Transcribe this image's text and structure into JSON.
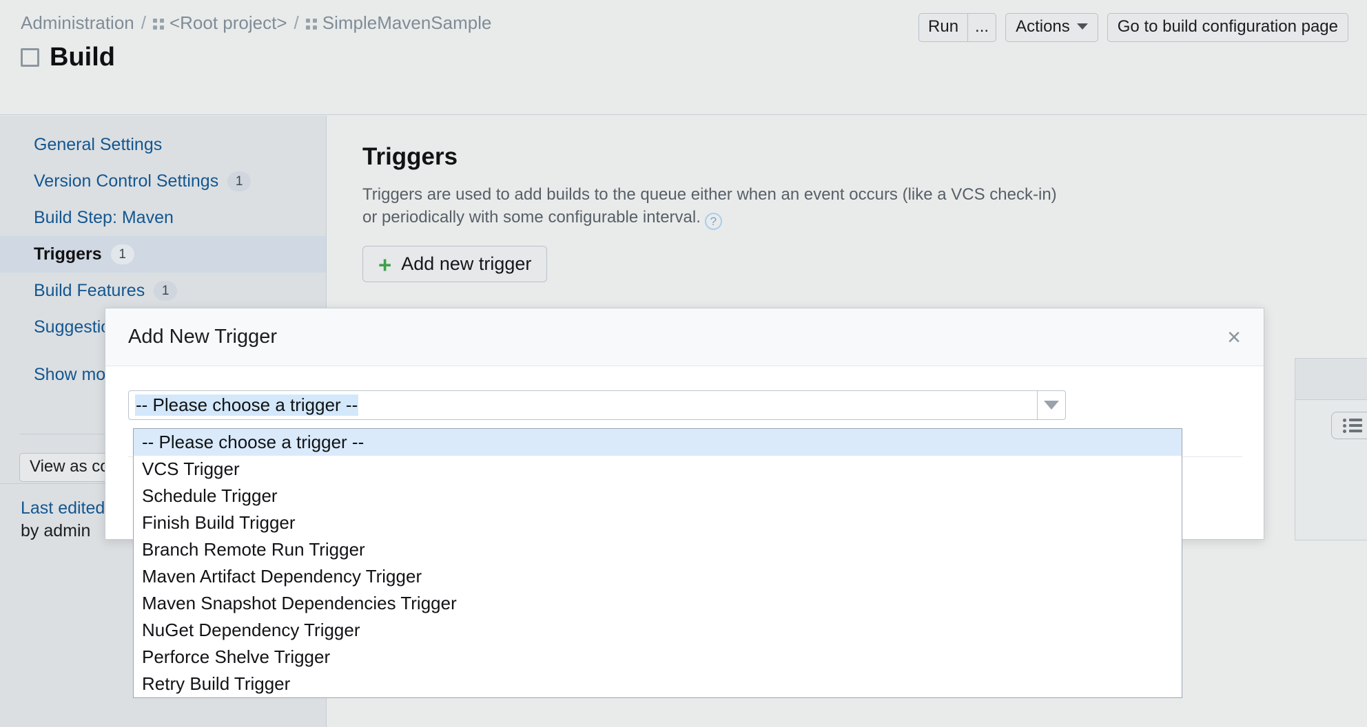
{
  "header": {
    "breadcrumb": [
      {
        "label": "Administration",
        "icon": null
      },
      {
        "label": "<Root project>",
        "icon": "grid-icon"
      },
      {
        "label": "SimpleMavenSample",
        "icon": "grid-icon"
      }
    ],
    "separator": "/",
    "page_title": "Build",
    "actions": {
      "run_label": "Run",
      "run_more_label": "...",
      "actions_label": "Actions",
      "goto_label": "Go to build configuration page"
    }
  },
  "sidebar": {
    "items": [
      {
        "label": "General Settings",
        "badge": null,
        "active": false
      },
      {
        "label": "Version Control Settings",
        "badge": "1",
        "active": false
      },
      {
        "label": "Build Step: Maven",
        "badge": null,
        "active": false
      },
      {
        "label": "Triggers",
        "badge": "1",
        "active": true
      },
      {
        "label": "Build Features",
        "badge": "1",
        "active": false
      },
      {
        "label": "Suggestions",
        "badge": null,
        "active": false
      },
      {
        "label": "Show more",
        "badge": null,
        "active": false
      }
    ],
    "footer": {
      "last_edited": "Last edited",
      "by_line": "by admin",
      "view_as_code_label": "View as code"
    }
  },
  "main": {
    "title": "Triggers",
    "description": "Triggers are used to add builds to the queue either when an event occurs (like a VCS check-in) or periodically with some configurable interval.",
    "help_icon": "?",
    "add_trigger_label": "Add new trigger",
    "add_trigger_plus": "+",
    "list_view_button": "list-view-icon"
  },
  "modal": {
    "title": "Add New Trigger",
    "close_label": "×",
    "select": {
      "value": "-- Please choose a trigger --",
      "expanded": true
    }
  },
  "dropdown": {
    "options": [
      {
        "label": "-- Please choose a trigger --",
        "selected": true
      },
      {
        "label": "VCS Trigger",
        "selected": false
      },
      {
        "label": "Schedule Trigger",
        "selected": false
      },
      {
        "label": "Finish Build Trigger",
        "selected": false
      },
      {
        "label": "Branch Remote Run Trigger",
        "selected": false
      },
      {
        "label": "Maven Artifact Dependency Trigger",
        "selected": false
      },
      {
        "label": "Maven Snapshot Dependencies Trigger",
        "selected": false
      },
      {
        "label": "NuGet Dependency Trigger",
        "selected": false
      },
      {
        "label": "Perforce Shelve Trigger",
        "selected": false
      },
      {
        "label": "Retry Build Trigger",
        "selected": false
      }
    ]
  },
  "colors": {
    "link": "#14568f",
    "sidebar_bg": "#dbdfe2",
    "main_bg": "#e9ebeb",
    "accent_green": "#3fa14b",
    "highlight": "#daeafb",
    "border": "#c5ccd4"
  }
}
